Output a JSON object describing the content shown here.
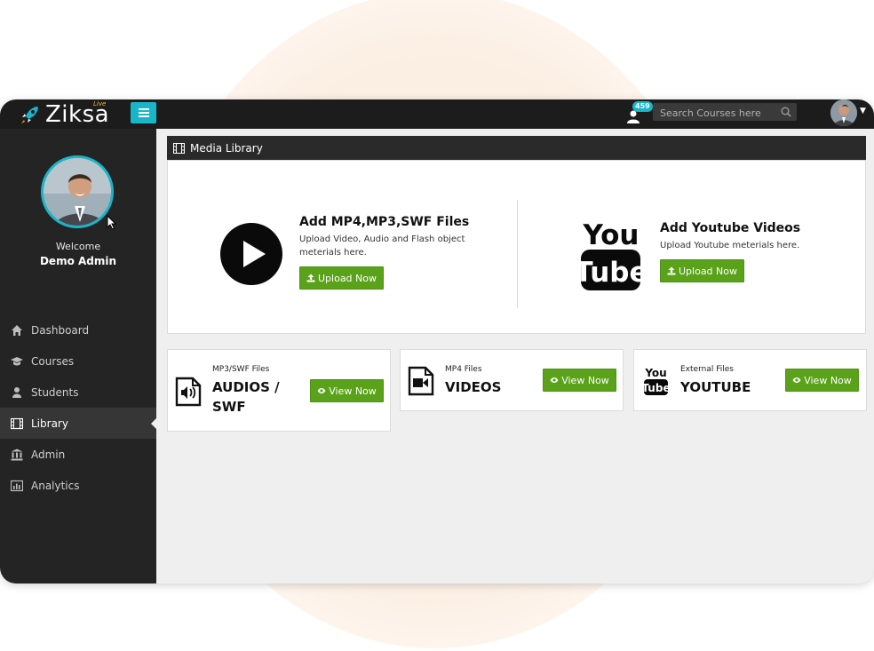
{
  "app": {
    "brand": "Ziksa",
    "brand_tag": "Live"
  },
  "topbar": {
    "notification_count": "459",
    "search_placeholder": "Search Courses here"
  },
  "sidebar": {
    "welcome": "Welcome",
    "user_name": "Demo Admin",
    "items": [
      {
        "label": "Dashboard",
        "icon": "home-icon"
      },
      {
        "label": "Courses",
        "icon": "graduation-cap-icon"
      },
      {
        "label": "Students",
        "icon": "user-icon"
      },
      {
        "label": "Library",
        "icon": "film-icon",
        "active": true
      },
      {
        "label": "Admin",
        "icon": "bank-icon"
      },
      {
        "label": "Analytics",
        "icon": "bar-chart-icon"
      }
    ]
  },
  "media_library": {
    "title": "Media Library",
    "file_upload": {
      "title": "Add MP4,MP3,SWF Files",
      "description": "Upload Video, Audio and Flash object meterials here.",
      "button": "Upload Now"
    },
    "youtube_upload": {
      "title": "Add Youtube Videos",
      "description": "Upload Youtube meterials here.",
      "button": "Upload Now"
    }
  },
  "cards": [
    {
      "small": "MP3/SWF Files",
      "big": "AUDIOS / SWF",
      "button": "View Now",
      "icon": "audio-file-icon"
    },
    {
      "small": "MP4 Files",
      "big": "VIDEOS",
      "button": "View Now",
      "icon": "video-file-icon"
    },
    {
      "small": "External Files",
      "big": "YOUTUBE",
      "button": "View Now",
      "icon": "youtube-icon"
    }
  ],
  "colors": {
    "accent": "#19b5c9",
    "button_green": "#5aa21a",
    "sidebar": "#242424",
    "topbar": "#1c1c1c"
  }
}
